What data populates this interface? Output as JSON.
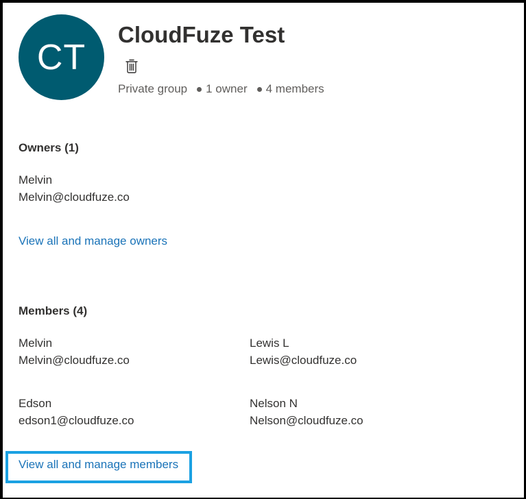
{
  "group": {
    "initials": "CT",
    "name": "CloudFuze Test",
    "privacy": "Private group",
    "owner_count": "1 owner",
    "member_count": "4 members",
    "avatar_color": "#005b70",
    "delete_icon": "trash-icon"
  },
  "owners": {
    "heading": "Owners (1)",
    "list": [
      {
        "name": "Melvin",
        "email": "Melvin@cloudfuze.co"
      }
    ],
    "manage_link": "View all and manage owners"
  },
  "members": {
    "heading": "Members (4)",
    "list": [
      {
        "name": "Melvin",
        "email": "Melvin@cloudfuze.co"
      },
      {
        "name": "Lewis L",
        "email": "Lewis@cloudfuze.co"
      },
      {
        "name": "Edson",
        "email": "edson1@cloudfuze.co"
      },
      {
        "name": "Nelson N",
        "email": "Nelson@cloudfuze.co"
      }
    ],
    "manage_link": "View all and manage members"
  },
  "colors": {
    "link": "#1a73b8",
    "highlight_border": "#1ba1e2"
  }
}
